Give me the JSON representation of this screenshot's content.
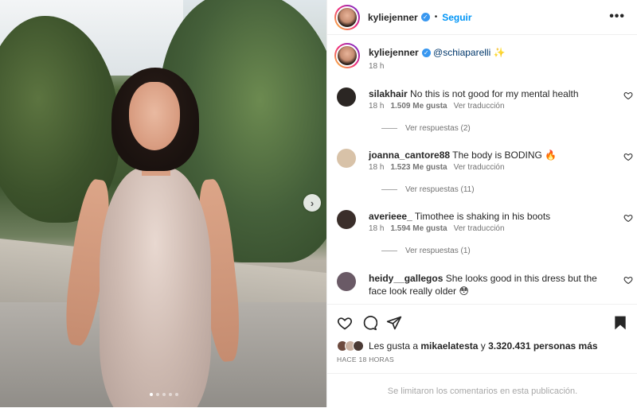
{
  "post_image": {
    "next_symbol": "›",
    "carousel_dots": 5,
    "active_dot": 0
  },
  "header": {
    "username": "kyliejenner",
    "separator": "•",
    "follow_label": "Seguir",
    "more_symbol": "•••"
  },
  "caption": {
    "username": "kyliejenner",
    "mention": "@schiaparelli",
    "emoji": "✨",
    "time": "18 h"
  },
  "comments": [
    {
      "username": "silakhair",
      "text": "No this is not good for my mental health",
      "time": "18 h",
      "likes": "1.509 Me gusta",
      "translate": "Ver traducción",
      "replies": "Ver respuestas (2)",
      "avatar_color": "#2b2623"
    },
    {
      "username": "joanna_cantore88",
      "text": "The body is BODING 🔥",
      "time": "18 h",
      "likes": "1.523 Me gusta",
      "translate": "Ver traducción",
      "replies": "Ver respuestas (11)",
      "avatar_color": "#d8c2a8"
    },
    {
      "username": "averieee_",
      "text": "Timothee is shaking in his boots",
      "time": "18 h",
      "likes": "1.594 Me gusta",
      "translate": "Ver traducción",
      "replies": "Ver respuestas (1)",
      "avatar_color": "#3a2e2a"
    },
    {
      "username": "heidy__gallegos",
      "text": "She looks good in this dress but the face look really older 😳",
      "time": "",
      "likes": "",
      "translate": "",
      "replies": "",
      "avatar_color": "#6a5a66"
    }
  ],
  "likes_line": {
    "prefix": "Les gusta a",
    "user": "mikaelatesta",
    "middle": "y",
    "count": "3.320.431 personas más"
  },
  "timestamp": "HACE 18 HORAS",
  "comments_limited": "Se limitaron los comentarios en esta publicación.",
  "colors": {
    "accent": "#0095f6",
    "verified": "#3897f0",
    "muted": "#737373"
  }
}
